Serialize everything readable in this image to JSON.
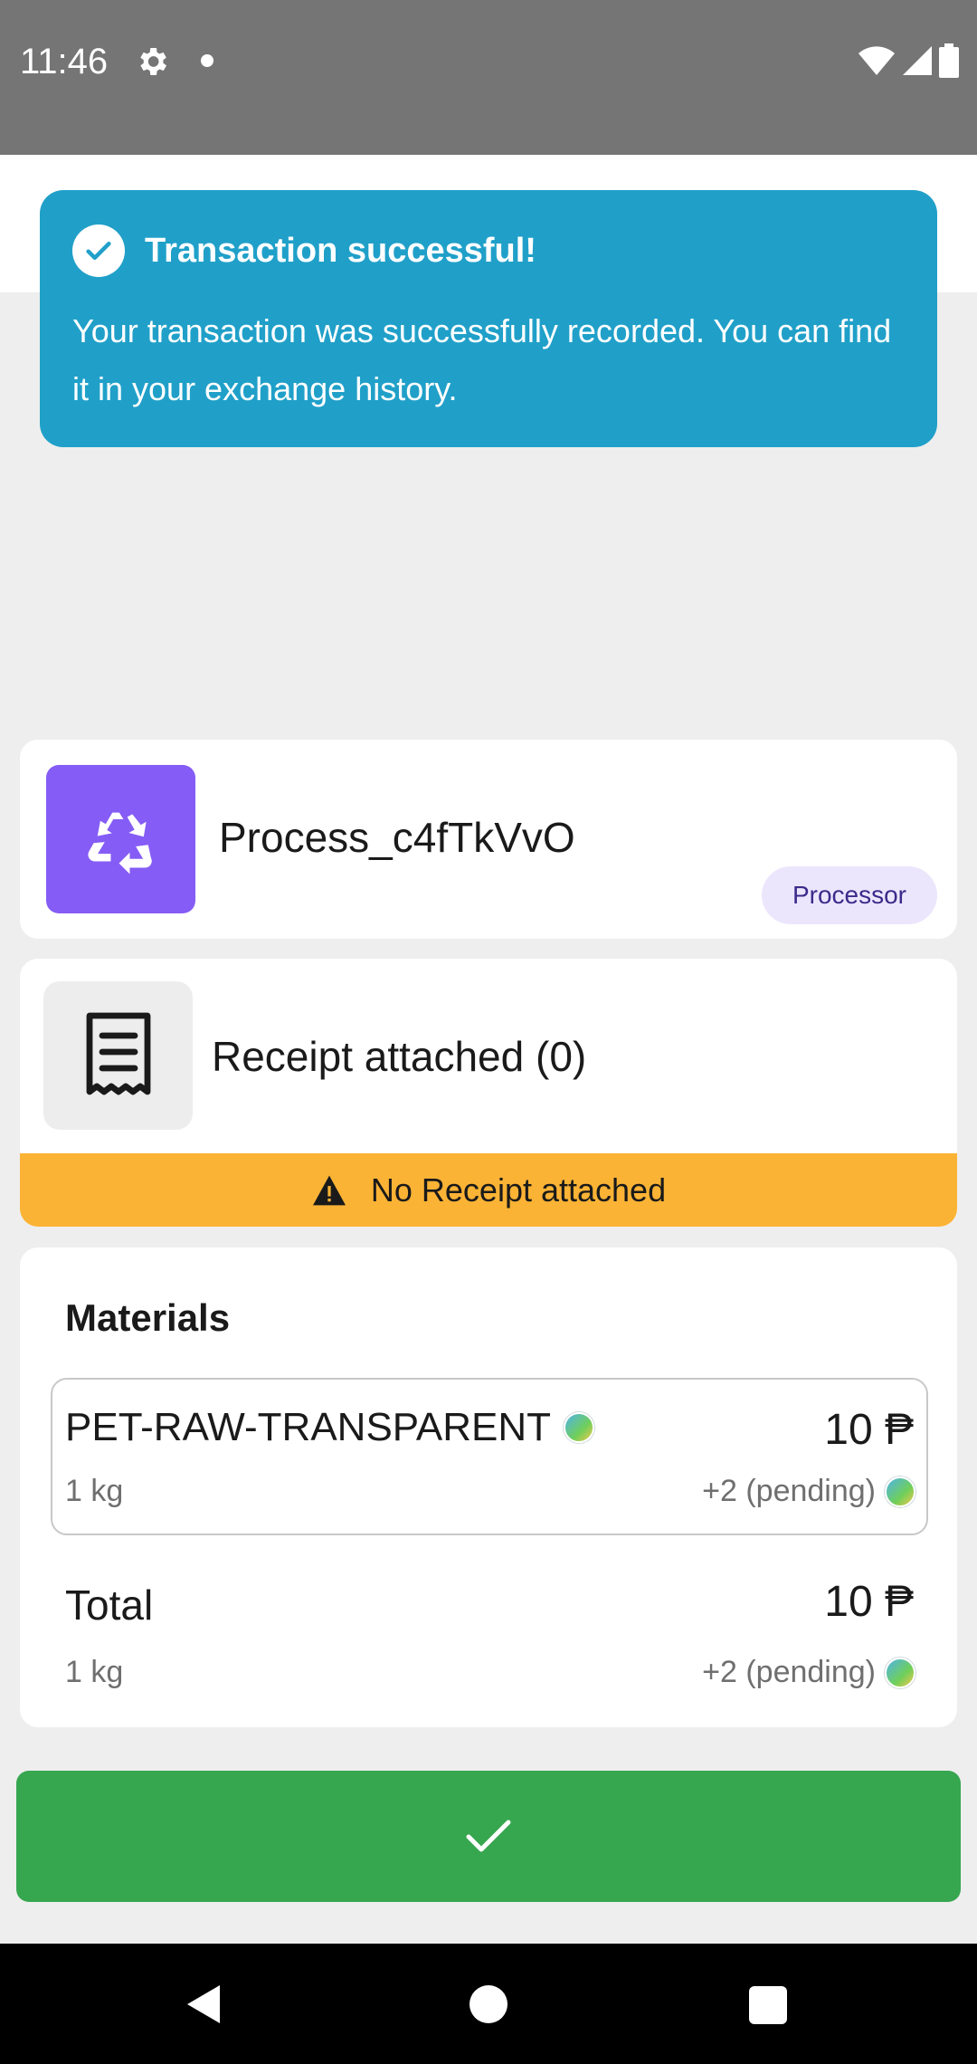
{
  "status_bar": {
    "time": "11:46"
  },
  "toast": {
    "title": "Transaction successful!",
    "message": "Your transaction was successfully recorded. You can find it in your exchange history."
  },
  "process": {
    "name": "Process_c4fTkVvO",
    "badge": "Processor",
    "icon": "recycle-icon"
  },
  "receipt": {
    "title": "Receipt attached (0)",
    "warning": "No Receipt attached",
    "icon": "receipt-icon"
  },
  "materials": {
    "heading": "Materials",
    "items": [
      {
        "name": "PET-RAW-TRANSPARENT",
        "price": "10 ₱",
        "quantity": "1 kg",
        "pending": "+2 (pending)"
      }
    ],
    "total": {
      "label": "Total",
      "price": "10 ₱",
      "quantity": "1 kg",
      "pending": "+2 (pending)"
    }
  },
  "colors": {
    "toast": "#20a0c9",
    "process_icon": "#855cf5",
    "badge_bg": "#ece6fd",
    "warning": "#fbb335",
    "confirm": "#36a64f"
  }
}
